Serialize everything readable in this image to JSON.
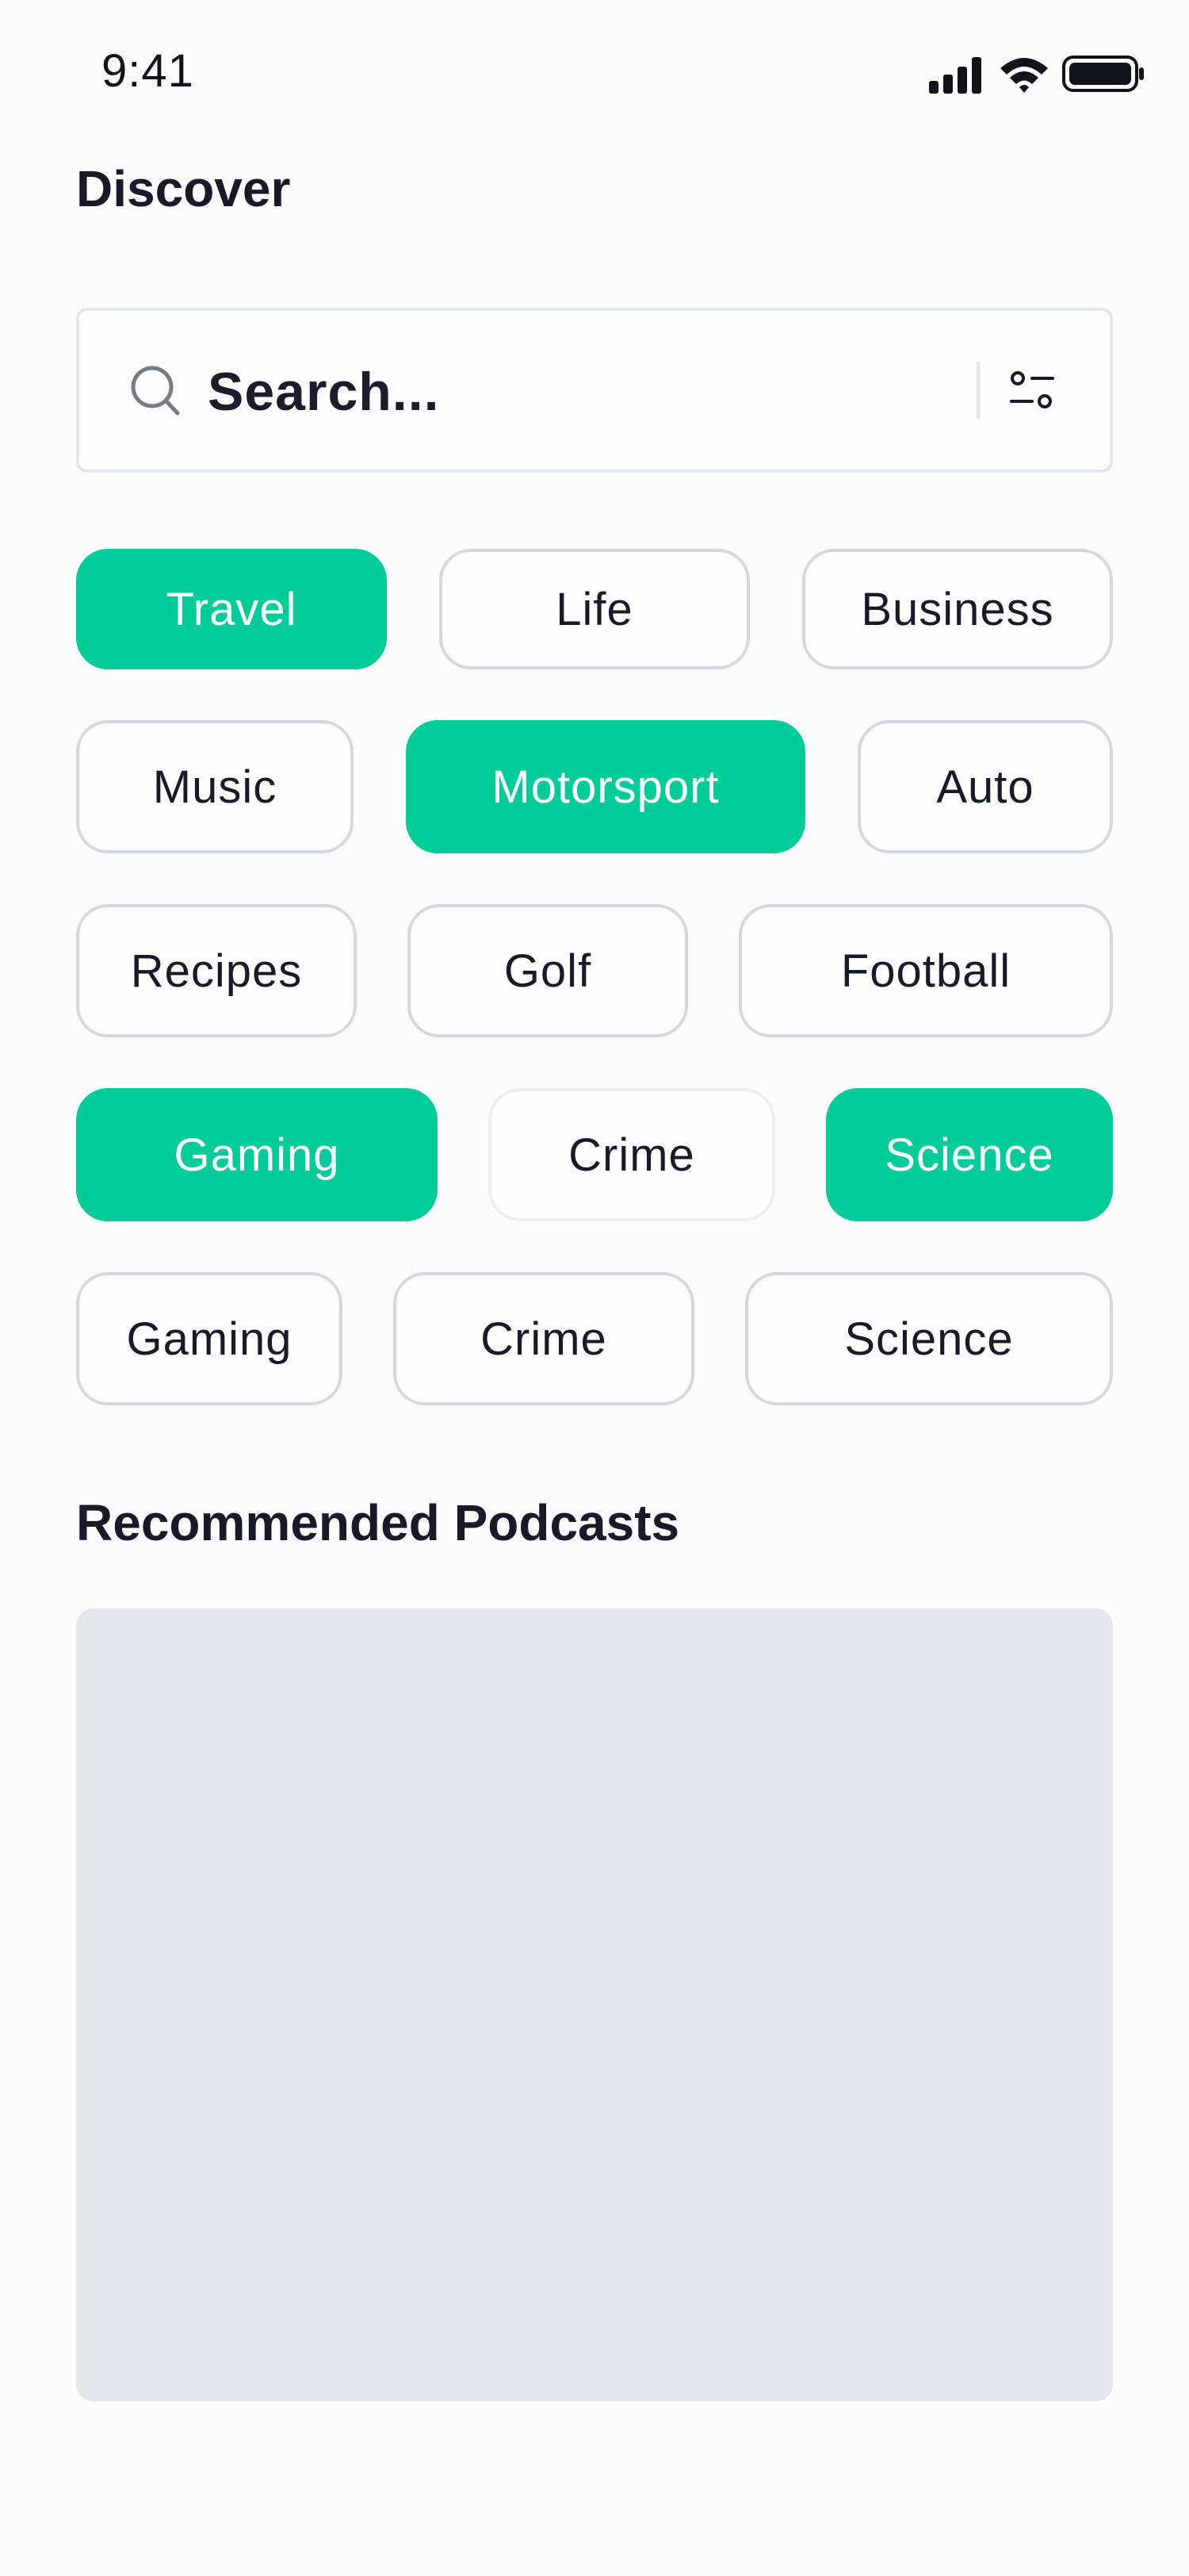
{
  "status_bar": {
    "time": "9:41",
    "icons": [
      "cellular-signal-icon",
      "wifi-icon",
      "battery-icon"
    ]
  },
  "header": {
    "title": "Discover"
  },
  "search": {
    "placeholder": "Search...",
    "icon": "search-icon",
    "filter_icon": "filter-sliders-icon"
  },
  "categories": [
    {
      "label": "Travel",
      "selected": true
    },
    {
      "label": "Life",
      "selected": false
    },
    {
      "label": "Business",
      "selected": false
    },
    {
      "label": "Music",
      "selected": false
    },
    {
      "label": "Motorsport",
      "selected": true
    },
    {
      "label": "Auto",
      "selected": false
    },
    {
      "label": "Recipes",
      "selected": false
    },
    {
      "label": "Golf",
      "selected": false
    },
    {
      "label": "Football",
      "selected": false
    },
    {
      "label": "Gaming",
      "selected": true
    },
    {
      "label": "Crime",
      "selected": false
    },
    {
      "label": "Science",
      "selected": true
    },
    {
      "label": "Gaming",
      "selected": false
    },
    {
      "label": "Crime",
      "selected": false
    },
    {
      "label": "Science",
      "selected": false
    }
  ],
  "recommended": {
    "title": "Recommended Podcasts"
  },
  "colors": {
    "accent": "#00CC99",
    "chip_border": "#D6D9DC",
    "placeholder_card": "#E4E8EC",
    "text": "#181A27"
  }
}
